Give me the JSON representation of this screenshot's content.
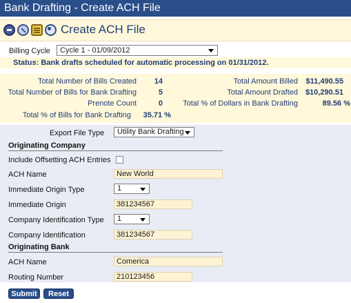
{
  "window": {
    "title": "Bank Drafting - Create ACH File"
  },
  "toolbar": {
    "icons": [
      "save-disk-icon",
      "check-icon",
      "notes-icon",
      "refresh-icon"
    ],
    "title": "Create ACH File"
  },
  "billing_cycle": {
    "label": "Billing Cycle",
    "value": "Cycle 1 - 01/09/2012"
  },
  "status": {
    "text": "Status:  Bank drafts scheduled for automatic processing on 01/31/2012."
  },
  "summary": {
    "left": [
      {
        "label": "Total Number of Bills Created",
        "value": "14"
      },
      {
        "label": "Total Number of Bills for Bank Drafting",
        "value": "5"
      },
      {
        "label": "Prenote Count",
        "value": "0"
      },
      {
        "label": "Total % of Bills for Bank Drafting",
        "value": "35.71 %"
      }
    ],
    "right": [
      {
        "label": "Total Amount Billed",
        "value": "$11,490.55"
      },
      {
        "label": "Total Amount Drafted",
        "value": "$10,290.51"
      },
      {
        "label": "Total % of Dollars in Bank Drafting",
        "value": "89.56 %"
      }
    ]
  },
  "form": {
    "export_file_type": {
      "label": "Export File Type",
      "value": "Utility Bank Drafting"
    },
    "originating_company": {
      "heading": "Originating Company",
      "include_offsetting": {
        "label": "Include Offsetting ACH Entries",
        "checked": false
      },
      "ach_name": {
        "label": "ACH Name",
        "value": "New World"
      },
      "immediate_origin_type": {
        "label": "Immediate Origin Type",
        "value": "1"
      },
      "immediate_origin": {
        "label": "Immediate Origin",
        "value": "381234567"
      },
      "company_id_type": {
        "label": "Company Identification Type",
        "value": "1"
      },
      "company_id": {
        "label": "Company Identification",
        "value": "381234567"
      }
    },
    "originating_bank": {
      "heading": "Originating Bank",
      "ach_name": {
        "label": "ACH Name",
        "value": "Comerica"
      },
      "routing_number": {
        "label": "Routing Number",
        "value": "210123456"
      }
    }
  },
  "buttons": {
    "submit": "Submit",
    "reset": "Reset"
  },
  "colors": {
    "accent": "#2a4e8a",
    "panel": "#fff8da",
    "form_bg": "#e9ecf4",
    "field_bg": "#fdf3d4"
  }
}
